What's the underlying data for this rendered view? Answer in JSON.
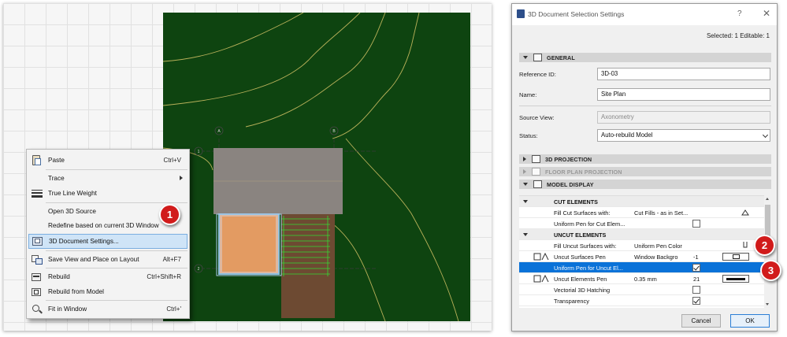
{
  "context_menu": {
    "items": [
      {
        "label": "Paste",
        "shortcut": "Ctrl+V",
        "icon": "paste-icon"
      },
      {
        "label": "Trace",
        "shortcut": "",
        "icon": "",
        "submenu": true
      },
      {
        "label": "True Line Weight",
        "shortcut": "",
        "icon": "line-weight-icon"
      },
      {
        "label": "Open 3D Source",
        "shortcut": "",
        "icon": ""
      },
      {
        "label": "Redefine based on current 3D Window",
        "shortcut": "",
        "icon": ""
      },
      {
        "label": "3D Document Settings...",
        "shortcut": "",
        "icon": "3d-document-settings-icon",
        "selected": true
      },
      {
        "label": "Save View and Place on Layout",
        "shortcut": "Alt+F7",
        "icon": "save-view-icon"
      },
      {
        "label": "Rebuild",
        "shortcut": "Ctrl+Shift+R",
        "icon": "rebuild-icon"
      },
      {
        "label": "Rebuild from Model",
        "shortcut": "",
        "icon": "rebuild-model-icon"
      },
      {
        "label": "Fit in Window",
        "shortcut": "Ctrl+'",
        "icon": "fit-window-icon"
      }
    ]
  },
  "callouts": [
    "1",
    "2",
    "3"
  ],
  "colors": {
    "accent": "#0a72d8",
    "callout": "#d11b1b",
    "site_bg": "#0e4410"
  },
  "canvas": {
    "grid_bubbles": [
      "A",
      "B",
      "1",
      "2"
    ]
  },
  "dialog": {
    "title": "3D Document Selection Settings",
    "help": "?",
    "close": "✕",
    "selected_info": "Selected: 1 Editable: 1",
    "general": {
      "header": "GENERAL",
      "reference_id_label": "Reference ID:",
      "reference_id_value": "3D-03",
      "name_label": "Name:",
      "name_value": "Site Plan",
      "source_view_label": "Source View:",
      "source_view_value": "Axonometry",
      "status_label": "Status:",
      "status_value": "Auto-rebuild Model"
    },
    "sections": {
      "projection_3d": "3D PROJECTION",
      "floor_plan_projection": "FLOOR PLAN PROJECTION",
      "model_display": "MODEL DISPLAY"
    },
    "model_display": {
      "cut_elements_header": "CUT ELEMENTS",
      "fill_cut_label": "Fill Cut Surfaces with:",
      "fill_cut_value": "Cut Fills - as in Set...",
      "uniform_pen_cut_label": "Uniform Pen for Cut Elem...",
      "uncut_elements_header": "UNCUT ELEMENTS",
      "fill_uncut_label": "Fill Uncut Surfaces with:",
      "fill_uncut_value": "Uniform Pen Color",
      "uncut_surfaces_pen_label": "Uncut Surfaces Pen",
      "uncut_surfaces_pen_value": "Window Backgro",
      "uncut_surfaces_pen_num": "-1",
      "uniform_pen_uncut_label": "Uniform Pen for Uncut El...",
      "uncut_elements_pen_label": "Uncut Elements Pen",
      "uncut_elements_pen_value": "0.35 mm",
      "uncut_elements_pen_num": "21",
      "vectorial_hatching_label": "Vectorial 3D Hatching",
      "transparency_label": "Transparency"
    },
    "cancel_label": "Cancel",
    "ok_label": "OK"
  }
}
